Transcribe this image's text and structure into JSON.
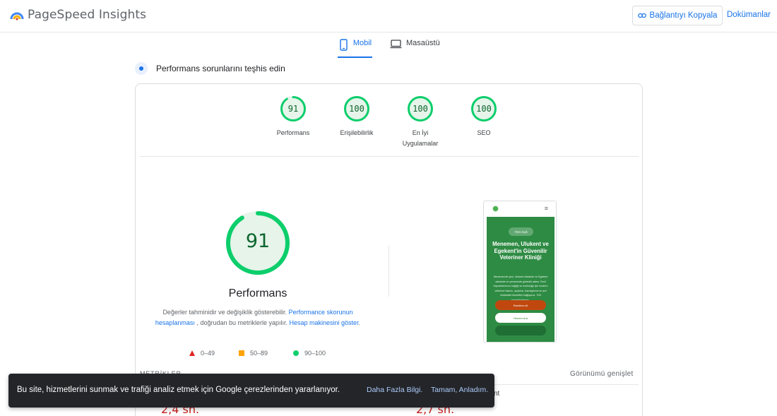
{
  "header": {
    "app_title": "PageSpeed Insights",
    "copy_link_label": "Bağlantıyı Kopyala",
    "docs_label": "Dokümanlar",
    "brand_color": "#1a73e8"
  },
  "tabs": [
    {
      "label": "Mobil",
      "active": true,
      "icon": "smartphone-icon"
    },
    {
      "label": "Masaüstü",
      "active": false,
      "icon": "laptop-icon"
    }
  ],
  "diagnose_title": "Performans sorunlarını teşhis edin",
  "scores": [
    {
      "value": "91",
      "label_line1": "Performans",
      "label_line2": "",
      "fraction": 0.91
    },
    {
      "value": "100",
      "label_line1": "Erişilebilirlik",
      "label_line2": "",
      "fraction": 1.0
    },
    {
      "value": "100",
      "label_line1": "En İyi",
      "label_line2": "Uygulamalar",
      "fraction": 1.0
    },
    {
      "value": "100",
      "label_line1": "SEO",
      "label_line2": "",
      "fraction": 1.0
    }
  ],
  "performance": {
    "score": "91",
    "fraction": 0.91,
    "label": "Performans",
    "desc_part1": "Değerler tahminidir ve değişiklik gösterebilir. ",
    "desc_link1": "Performance skorunun hesaplanması",
    "desc_part2": " , doğrudan bu metriklerle yapılır. ",
    "desc_link2": "Hesap makinesini göster",
    "desc_part3": "."
  },
  "legend": [
    {
      "range": "0–49",
      "color": "#e02424"
    },
    {
      "range": "50–89",
      "color": "#ffa400"
    },
    {
      "range": "90–100",
      "color": "#0cce6b"
    }
  ],
  "preview": {
    "badge": "7/24 Açık",
    "heading": "Menemen, Ulukent ve Egekent'in Güvenilir Veteriner Kliniği",
    "text": "Menemen'de yeni, Ulukent sitesinde ve Egekent sitesinde ve çevresinde güvenilir adres. Evcil hayvanlarınızın sağlığı ve mutluluğu için modern veteriner bakımı, aşılama, kısırlaştırma ve acil müdahale hizmetleri sağlıyoruz. 7/24 hizmetinizdeyiz.",
    "btn1": "Randevu Al",
    "btn2": "Hemen Ara",
    "accent": "#2e8b43"
  },
  "metrics": {
    "section_label": "METRİKLER",
    "expand_label": "Görünümü genişlet",
    "value_left": "2,4 sn.",
    "value_right": "2,7 sn.",
    "label_right_fragment": "nt"
  },
  "cookie": {
    "text": "Bu site, hizmetlerini sunmak ve trafiği analiz etmek için Google çerezlerinden yararlanıyor.",
    "more_label": "Daha Fazla Bilgi.",
    "ok_label": "Tamam, Anladım."
  }
}
